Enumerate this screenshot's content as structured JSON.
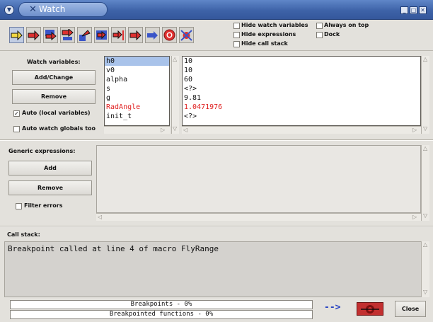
{
  "window": {
    "title": "Watch"
  },
  "options": {
    "hide_watch_variables": {
      "label": "Hide watch variables",
      "checked": false
    },
    "hide_expressions": {
      "label": "Hide expressions",
      "checked": false
    },
    "hide_call_stack": {
      "label": "Hide call stack",
      "checked": false
    },
    "always_on_top": {
      "label": "Always on top",
      "checked": false
    },
    "dock": {
      "label": "Dock",
      "checked": false
    }
  },
  "watch": {
    "heading": "Watch variables:",
    "add_change_label": "Add/Change",
    "remove_label": "Remove",
    "auto_local": {
      "label": "Auto (local variables)",
      "checked": true
    },
    "auto_globals": {
      "label": "Auto watch globals too",
      "checked": false
    },
    "names": [
      "h0",
      "v0",
      "alpha",
      "s",
      "g",
      "RadAngle",
      "init_t"
    ],
    "values": [
      "10",
      "10",
      "60",
      "<?>",
      "9.81",
      "1.0471976",
      "<?>"
    ],
    "highlight_color": "#e02020",
    "highlighted_row": 5,
    "selected_row": 0
  },
  "expressions": {
    "heading": "Generic expressions:",
    "add_label": "Add",
    "remove_label": "Remove",
    "filter_errors": {
      "label": "Filter errors",
      "checked": false
    }
  },
  "callstack": {
    "heading": "Call stack:",
    "lines": [
      "Breakpoint called at line 4 of macro FlyRange"
    ]
  },
  "status": {
    "breakpoints": {
      "text": "Breakpoints - 0%",
      "progress": 0
    },
    "functions": {
      "text": "Breakpointed functions - 0%",
      "progress": 0
    }
  },
  "footer": {
    "step_arrow": "-->",
    "close_label": "Close"
  },
  "colors": {
    "titlebar": "#3e63a8",
    "accent_red": "#e02020",
    "toolbar_blue": "#3a55c8"
  }
}
